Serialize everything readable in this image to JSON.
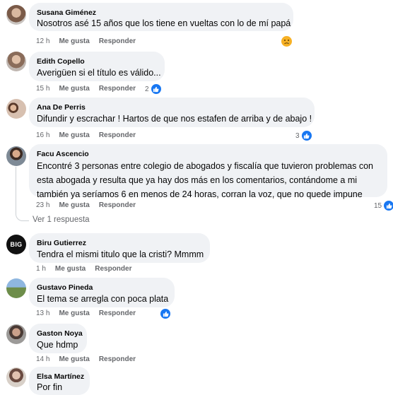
{
  "labels": {
    "like": "Me gusta",
    "reply": "Responder"
  },
  "comments": [
    {
      "author": "Susana Giménez",
      "lines": [
        "Nosotros asé 15 años que los tiene en vueltas con lo de mí papá"
      ],
      "time": "12 h",
      "reaction": "sad",
      "reaction_count": ""
    },
    {
      "author": "Edith Copello",
      "lines": [
        "Averigüen si el título es válido..."
      ],
      "time": "15 h",
      "reaction": "like",
      "reaction_count": "2"
    },
    {
      "author": "Ana De Perris",
      "lines": [
        "Difundir y escrachar ! Hartos de que nos estafen de arriba y de abajo !"
      ],
      "time": "16 h",
      "reaction": "like",
      "reaction_count": "3"
    },
    {
      "author": "Facu Ascencio",
      "lines": [
        "Encontré 3 personas entre colegio de abogados y fiscalía que tuvieron problemas con",
        "esta abogada y resulta que ya hay dos más en los comentarios, contándome a mi",
        "también ya seríamos 6 en menos de 24 horas, corran la voz, que no quede impune"
      ],
      "time": "23 h",
      "reaction": "like",
      "reaction_count": "15",
      "replies": "Ver 1 respuesta"
    },
    {
      "author": "Biru Gutierrez",
      "avatar_text": "BIG",
      "lines": [
        "Tendra el mismi titulo que la cristi? Mmmm"
      ],
      "time": "1 h",
      "reaction": "",
      "reaction_count": ""
    },
    {
      "author": "Gustavo Pineda",
      "lines": [
        "El tema se arregla con poca plata"
      ],
      "time": "13 h",
      "reaction": "like",
      "reaction_count": ""
    },
    {
      "author": "Gaston Noya",
      "lines": [
        "Que hdmp"
      ],
      "time": "14 h",
      "reaction": "",
      "reaction_count": ""
    },
    {
      "author": "Elsa Martínez",
      "lines": [
        "Por fin"
      ],
      "time": "",
      "reaction": "",
      "reaction_count": ""
    }
  ]
}
